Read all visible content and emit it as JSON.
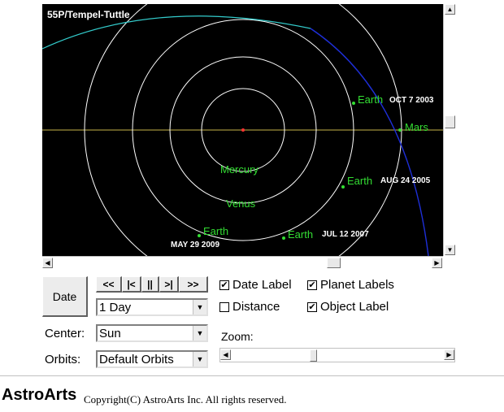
{
  "viewer": {
    "object_name": "55P/Tempel-Tuttle",
    "planets": {
      "mercury": "Mercury",
      "venus": "Venus",
      "earth": "Earth",
      "mars": "Mars"
    },
    "dates": {
      "d1": "OCT 7 2003",
      "d2": "AUG 24 2005",
      "d3": "JUL 12 2007",
      "d4": "MAY 29 2009"
    },
    "colors": {
      "background": "#000000",
      "orbit": "#ffffff",
      "planet_label": "#33dd33",
      "comet_orbit": "#1e2fd8",
      "comet_orbit_far": "#33cccc",
      "ecliptic_line": "#c9b44a",
      "sun": "#ff3333"
    }
  },
  "controls": {
    "date_button": "Date",
    "nav": {
      "fast_back": "<<",
      "step_back": "|<",
      "pause": "||",
      "step_forward": ">|",
      "fast_forward": ">>"
    },
    "step_select": "1 Day",
    "center_label": "Center:",
    "center_select": "Sun",
    "orbits_label": "Orbits:",
    "orbits_select": "Default Orbits",
    "checkboxes": {
      "date_label": "Date Label",
      "distance": "Distance",
      "planet_labels": "Planet Labels",
      "object_label": "Object Label"
    },
    "checked": {
      "date_label": true,
      "distance": false,
      "planet_labels": true,
      "object_label": true
    },
    "zoom_label": "Zoom:"
  },
  "footer": {
    "brand": "AstroArts",
    "copyright": "Copyright(C) AstroArts Inc. All rights reserved."
  }
}
